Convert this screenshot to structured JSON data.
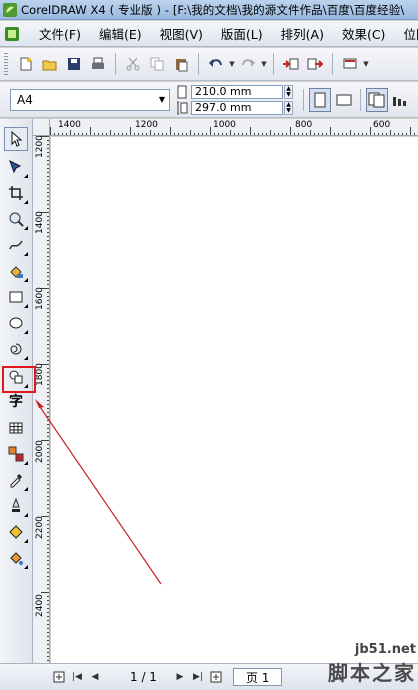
{
  "window": {
    "title": "CorelDRAW X4 ( 专业版 ) - [F:\\我的文档\\我的源文件作品\\百度\\百度经验\\"
  },
  "menu": {
    "items": [
      "文件(F)",
      "编辑(E)",
      "视图(V)",
      "版面(L)",
      "排列(A)",
      "效果(C)",
      "位图"
    ]
  },
  "property_bar": {
    "paper_size": "A4",
    "width": "210.0 mm",
    "height": "297.0 mm"
  },
  "rulers": {
    "horizontal_labels": [
      "1400",
      "1200",
      "1000",
      "800",
      "600"
    ],
    "vertical_labels": [
      "1200",
      "1400",
      "1600",
      "1800",
      "2000",
      "2200",
      "2400"
    ]
  },
  "toolbox": {
    "tools": [
      "pick-tool",
      "shape-tool",
      "crop-tool",
      "zoom-tool",
      "freehand-tool",
      "smart-fill-tool",
      "rectangle-tool",
      "ellipse-tool",
      "polygon-tool",
      "basic-shapes-tool",
      "text-tool",
      "table-tool",
      "interactive-blend-tool",
      "eyedropper-tool",
      "outline-tool",
      "fill-tool",
      "interactive-fill-tool"
    ],
    "text_tool_glyph": "字",
    "highlighted_tool": "basic-shapes-tool"
  },
  "status": {
    "page_count": "1 / 1",
    "page_tab": "页 1"
  },
  "watermark": {
    "site": "jb51.net",
    "name": "脚本之家"
  },
  "colors": {
    "highlight": "#e0181c",
    "arrow": "#c8202a",
    "canvas": "#ffffff"
  }
}
